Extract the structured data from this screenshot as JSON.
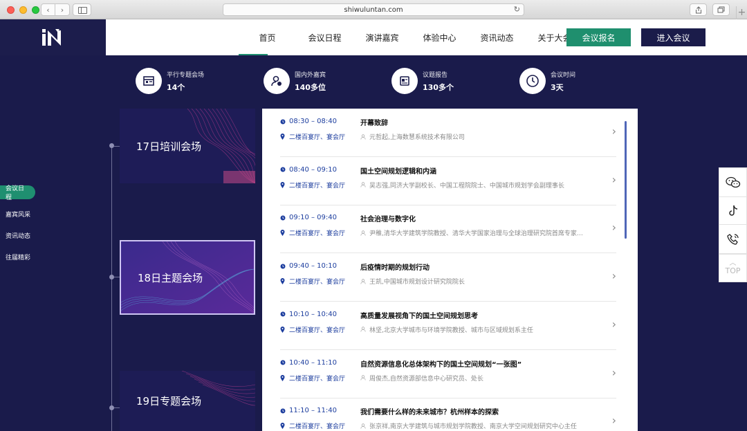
{
  "browser": {
    "url": "shiwuluntan.com"
  },
  "header": {
    "logo_alt": "iN",
    "nav": [
      "首页",
      "会议日程",
      "演讲嘉宾",
      "体验中心",
      "资讯动态",
      "关于大会"
    ],
    "register_label": "会议报名",
    "enter_label": "进入会议"
  },
  "stats": [
    {
      "label": "平行专题会场",
      "value": "14个",
      "icon": "calendar-board-icon"
    },
    {
      "label": "国内外嘉宾",
      "value": "140多位",
      "icon": "user-globe-icon"
    },
    {
      "label": "议题报告",
      "value": "130多个",
      "icon": "report-doc-icon"
    },
    {
      "label": "会议时间",
      "value": "3天",
      "icon": "clock-icon"
    }
  ],
  "subnav": [
    "会议日程",
    "嘉宾风采",
    "资讯动态",
    "往届精彩"
  ],
  "sessions": [
    "17日培训会场",
    "18日主题会场",
    "19日专题会场"
  ],
  "schedule": [
    {
      "time": "08:30 – 08:40",
      "location": "二楼百宴厅、宴会厅",
      "title": "开幕致辞",
      "speaker": "元哲起,上海数慧系统技术有限公司"
    },
    {
      "time": "08:40 – 09:10",
      "location": "二楼百宴厅、宴会厅",
      "title": "国土空间规划逻辑和内涵",
      "speaker": "吴志强,同济大学副校长、中国工程院院士、中国城市规划学会副理事长"
    },
    {
      "time": "09:10 – 09:40",
      "location": "二楼百宴厅、宴会厅",
      "title": "社会治理与数字化",
      "speaker": "尹稚,清华大学建筑学院教授、清华大学国家治理与全球治理研究院首席专家、…"
    },
    {
      "time": "09:40 – 10:10",
      "location": "二楼百宴厅、宴会厅",
      "title": "后疫情时期的规划行动",
      "speaker": "王凯,中国城市规划设计研究院院长"
    },
    {
      "time": "10:10 – 10:40",
      "location": "二楼百宴厅、宴会厅",
      "title": "高质量发展视角下的国土空间规划思考",
      "speaker": "林坚,北京大学城市与环境学院教授、城市与区域规划系主任"
    },
    {
      "time": "10:40 – 11:10",
      "location": "二楼百宴厅、宴会厅",
      "title": "自然资源信息化总体架构下的国土空间规划“一张图”",
      "speaker": "周俊杰,自然资源部信息中心研究员、处长"
    },
    {
      "time": "11:10 – 11:40",
      "location": "二楼百宴厅、宴会厅",
      "title": "我们需要什么样的未来城市？杭州样本的探索",
      "speaker": "张京祥,南京大学建筑与城市规划学院教授、南京大学空间规划研究中心主任"
    }
  ],
  "float": {
    "top_label": "TOP"
  }
}
